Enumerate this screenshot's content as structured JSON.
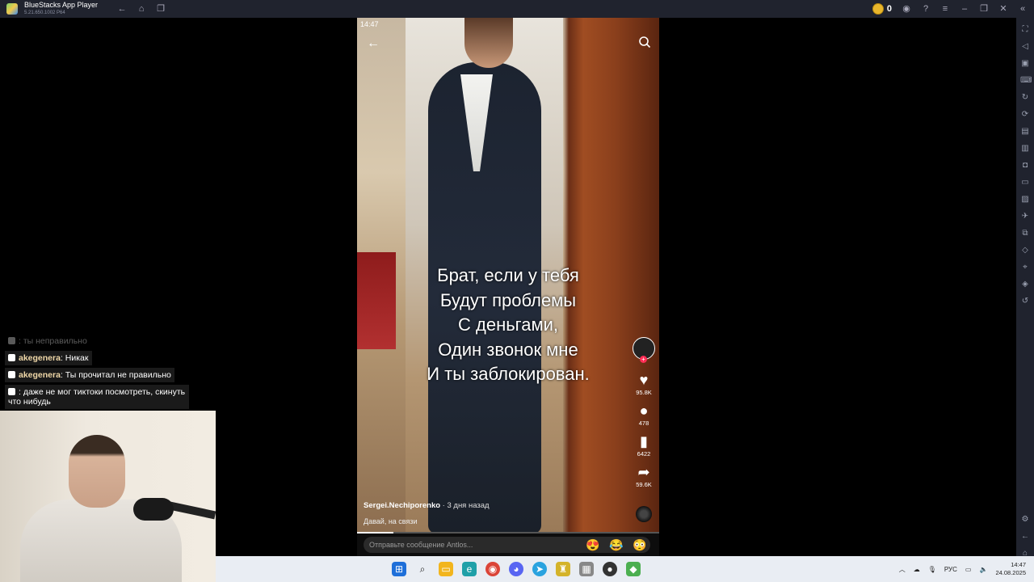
{
  "window": {
    "title": "BlueStacks App Player",
    "version": "5.21.650.1002 P64",
    "coins": "0"
  },
  "phone": {
    "status_time": "14:47",
    "caption_lines": [
      "Брат, если у тебя",
      "Будут проблемы",
      "С деньгами,",
      "Один звонок мне",
      "И ты заблокирован."
    ],
    "likes": "95.8K",
    "comments": "478",
    "saves": "6422",
    "shares": "59.6K",
    "author": "Sergei.Nechiporenko",
    "posted": "· 3 дня назад",
    "description": "Давай, на связи",
    "progress": 0.12
  },
  "messagebar": {
    "placeholder": "Отправьте сообщение Antlos...",
    "emojis": [
      "😍",
      "😂",
      "😳"
    ]
  },
  "chat": {
    "messages": [
      {
        "user": "",
        "text": ": ты неправильно"
      },
      {
        "user": "akegenera",
        "text": ": Никак"
      },
      {
        "user": "akegenera",
        "text": ": Ты прочитал не правильно"
      },
      {
        "user": "",
        "text": ": даже не мог тиктоки посмотреть, скинуть что нибудь"
      }
    ]
  },
  "taskbar": {
    "language": "РУС",
    "time": "14:47",
    "date": "24.08.2025"
  },
  "colors": {
    "titlebar": "#20232e",
    "taskbar": "#e9edf3",
    "like_red": "#ff2d55"
  }
}
